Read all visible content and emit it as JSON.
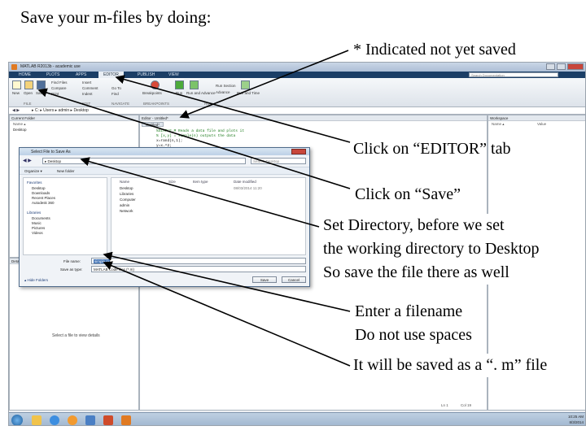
{
  "heading": "Save your m-files by doing:",
  "annotations": {
    "indicated": "* Indicated not yet saved",
    "editor_tab": "Click on “EDITOR” tab",
    "save": "Click on “Save”",
    "directory": [
      "Set Directory, before we set",
      "the working directory to Desktop",
      "So save the file there as well"
    ],
    "filename": [
      "Enter a filename",
      "Do not use spaces"
    ],
    "extension": "It will be saved as a “. m” file"
  },
  "matlab": {
    "title": "MATLAB R2013b - academic use",
    "tabs": [
      "HOME",
      "PLOTS",
      "APPS",
      "EDITOR",
      "PUBLISH",
      "VIEW"
    ],
    "search_placeholder": "Search Documentation",
    "ribbon": {
      "new": "New",
      "open": "Open",
      "save": "Save",
      "find_files": "Find Files",
      "compare": "Compare",
      "print": "Print",
      "insert": "Insert",
      "comment": "Comment",
      "indent": "Indent",
      "goto": "Go To",
      "find": "Find",
      "breakpoints": "Breakpoints",
      "run": "Run",
      "run_advance": "Run and Advance",
      "run_section": "Run Section",
      "advance": "Advance",
      "run_time": "Run and Time",
      "sections": [
        "FILE",
        "NAVIGATE",
        "EDIT",
        "BREAKPOINTS",
        "RUN"
      ]
    },
    "path": "▸ C: ▸ Users ▸ admin ▸ Desktop",
    "current_folder": {
      "header": "Current Folder",
      "col_name": "Name ▴",
      "items": [
        "Desktop"
      ],
      "details_header": "Details",
      "details_text": "Select a file to view details"
    },
    "editor": {
      "header": "Editor - Untitled*",
      "tab": "Untitled*",
      "lines": [
        "%SIMPLE.M Reads a data file and plots it",
        "% [x,y] = simple(n) outputs the data",
        "x=rand(n,1);",
        "y=x.^2;",
        "plot(x,y)"
      ]
    },
    "workspace": {
      "header": "Workspace",
      "col_name": "Name ▴",
      "col_value": "Value"
    },
    "status": {
      "ln": "Ln 1",
      "col": "Col 19"
    }
  },
  "dialog": {
    "title": "Select File to Save As",
    "address": "▸ Desktop",
    "search": "Search Desktop",
    "organize": "Organize ▾",
    "new_folder": "New folder",
    "nav": {
      "favorites_header": "Favorites",
      "favorites": [
        "Desktop",
        "Downloads",
        "Recent Places",
        "Autodesk 360"
      ],
      "libraries_header": "Libraries",
      "libraries": [
        "Documents",
        "Music",
        "Pictures",
        "Videos"
      ]
    },
    "cols": [
      "Name",
      "Size",
      "Item type",
      "Date modified"
    ],
    "files": [
      {
        "name": "Desktop",
        "size": "",
        "type": "",
        "date": "08/03/2014 11:20"
      },
      {
        "name": "Libraries",
        "size": "",
        "type": "",
        "date": ""
      },
      {
        "name": "Computer",
        "size": "",
        "type": "",
        "date": ""
      },
      {
        "name": "admin",
        "size": "",
        "type": "",
        "date": ""
      },
      {
        "name": "Network",
        "size": "",
        "type": "",
        "date": ""
      }
    ],
    "file_name_label": "File name:",
    "file_name_value": "simple.m",
    "save_type_label": "Save as type:",
    "save_type_value": "MATLAB Code files (*.m)",
    "hide_folders": "▴ Hide Folders",
    "save_button": "Save",
    "cancel_button": "Cancel"
  },
  "taskbar": {
    "time": "10:25 AM",
    "date": "8/3/2014"
  },
  "colors": {
    "toolstrip": "#1b3e66",
    "arrow": "#000000",
    "comment_green": "#1a7a1a"
  }
}
